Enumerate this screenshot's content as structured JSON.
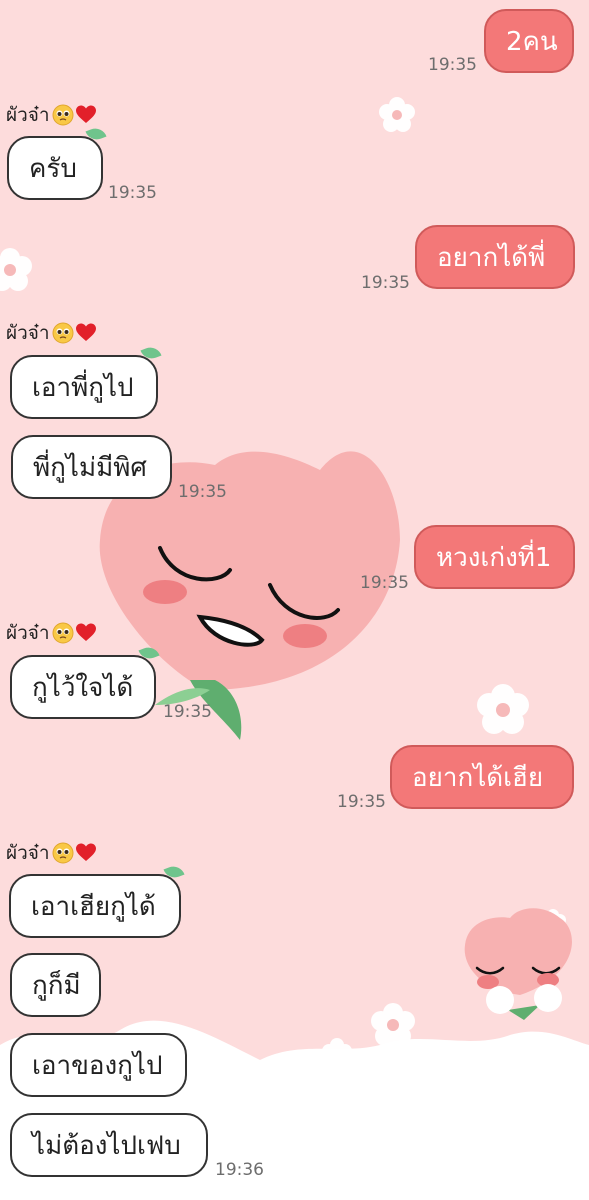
{
  "theme": {
    "background": "#fddcdc",
    "incoming_bubble": "#ffffff",
    "outgoing_bubble": "#f37878",
    "time_color": "#6d6d6d"
  },
  "messages": [
    {
      "dir": "out",
      "text": "2คน",
      "time": "19:35"
    },
    {
      "dir": "in",
      "sender": "ผัวจ๋า",
      "text": "ครับ",
      "time": "19:35"
    },
    {
      "dir": "out",
      "text": "อยากได้พี่",
      "time": "19:35"
    },
    {
      "dir": "in",
      "sender": "ผัวจ๋า",
      "text": "เอาพี่กูไป"
    },
    {
      "dir": "in",
      "text": "พี่กูไม่มีพิศ",
      "time": "19:35"
    },
    {
      "dir": "out",
      "text": "หวงเก่งที่1",
      "time": "19:35"
    },
    {
      "dir": "in",
      "sender": "ผัวจ๋า",
      "text": "กูไว้ใจได้",
      "time": "19:35"
    },
    {
      "dir": "out",
      "text": "อยากได้เฮีย",
      "time": "19:35"
    },
    {
      "dir": "in",
      "sender": "ผัวจ๋า",
      "text": "เอาเฮียกูได้"
    },
    {
      "dir": "in",
      "text": "กูก็มี"
    },
    {
      "dir": "in",
      "text": "เอาของกูไป"
    },
    {
      "dir": "in",
      "text": "ไม่ต้องไปเฟบ",
      "time": "19:36"
    }
  ]
}
